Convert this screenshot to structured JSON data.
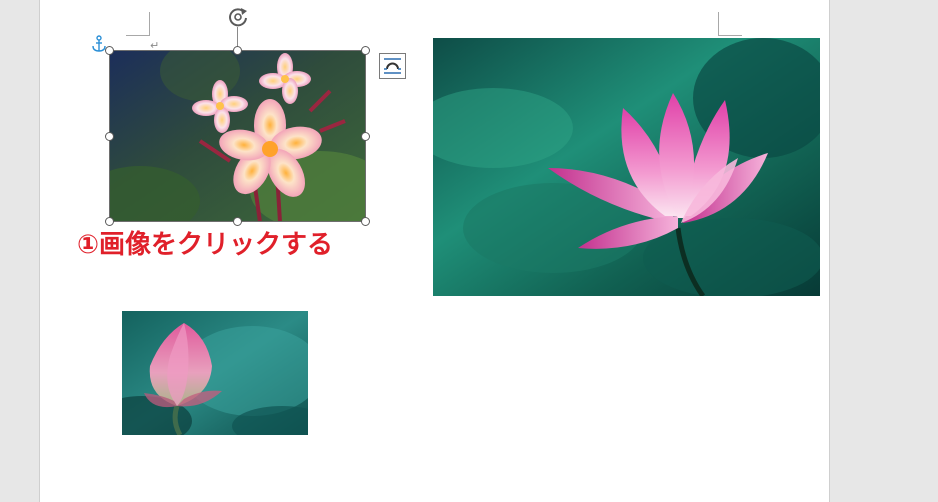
{
  "document": {
    "paragraph_mark": "↵"
  },
  "annotation": {
    "text": "①画像をクリックする",
    "color": "#e0202a"
  },
  "icons": {
    "anchor": "anchor-icon",
    "rotate": "rotate-icon",
    "layout_options": "layout-options-icon"
  },
  "colors": {
    "page_background": "#ffffff",
    "workspace_background": "#e7e7e7",
    "anchor_icon": "#2b8fd6",
    "selection_border": "#6e6e6e"
  }
}
